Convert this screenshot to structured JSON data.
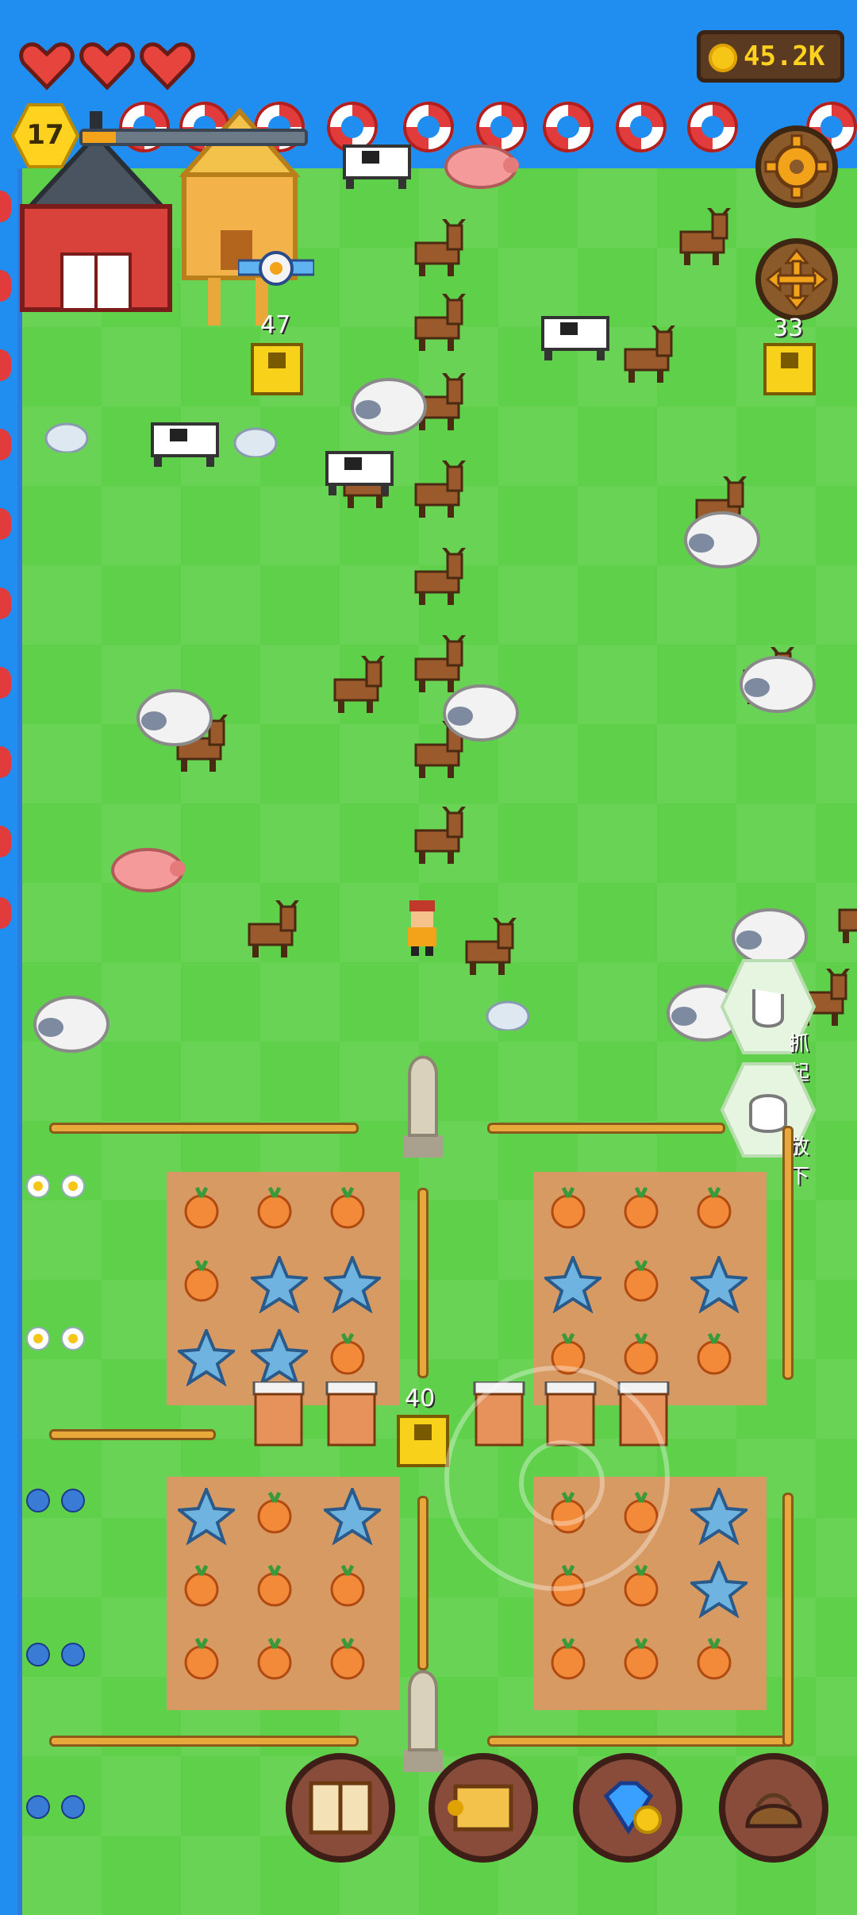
{
  "hud": {
    "hearts": 3,
    "coins": "45.2K",
    "level": "17",
    "xp_progress": 0.15
  },
  "world": {
    "house_counter": "47",
    "right_counter": "33",
    "middle_counter": "40"
  },
  "actions": {
    "pick_up": "抓起",
    "put_down": "放下"
  },
  "toolbar": [
    "book-icon",
    "map-scroll-icon",
    "gem-shop-icon",
    "bag-icon"
  ],
  "colors": {
    "water": "#1f8ef0",
    "grass": "#5fd04a",
    "soil": "#d89a63",
    "coin_text": "#ffd21f",
    "xp_fill": "#f2a31a"
  }
}
